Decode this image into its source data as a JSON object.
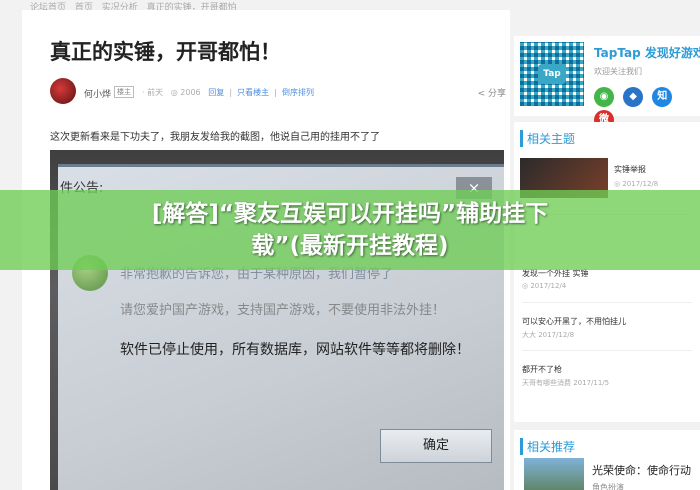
{
  "breadcrumb": [
    "论坛首页",
    "首页",
    "实况分析",
    "真正的实锤，开哥都怕"
  ],
  "article": {
    "title": "真正的实锤，开哥都怕！",
    "author": "何小烨",
    "author_tag": "楼主",
    "meta_time": "· 前天",
    "meta_views": "◎ 2006",
    "meta_actions": [
      "回复",
      "只看楼主",
      "倒序排列"
    ],
    "share_label": "分享",
    "lead": "这次更新看来是下功夫了，我朋友发给我的截图，他说自己用的挂用不了了"
  },
  "dialog": {
    "title": "件公告:",
    "close": "×",
    "line1": "非常抱歉的告诉您，由于某种原因，我们暂停了",
    "line2": "请您爱护国产游戏，支持国产游戏，不要使用非法外挂！",
    "line3": "软件已停止使用，所有数据库，网站软件等等都将删除！",
    "ok_label": "确定"
  },
  "sidebar": {
    "taptap_name": "TapTap 发现好游戏",
    "taptap_sub": "欢迎关注我们",
    "taptap_logo_text": "Tap",
    "socials": [
      "◉",
      "◆",
      "知",
      "微"
    ],
    "related_title": "相关主题",
    "related_items": [
      {
        "title": "实锤举报",
        "date": "◎ 2017/12/8"
      },
      {
        "title": "发现一个外挂 实锤",
        "date": "◎ 2017/12/4"
      },
      {
        "title": "可以安心开黑了，不用怕挂儿",
        "date": "大大 2017/12/8"
      },
      {
        "title": "都开不了枪",
        "date": "天哥有哪些消费  2017/11/5"
      }
    ],
    "recommend_title": "相关推荐",
    "recommend_game": "光荣使命：使命行动",
    "recommend_sub": "角色扮演"
  },
  "banner": {
    "line1": "[解答]“聚友互娱可以开挂吗”辅助挂下",
    "line2": "载”(最新开挂教程)"
  }
}
